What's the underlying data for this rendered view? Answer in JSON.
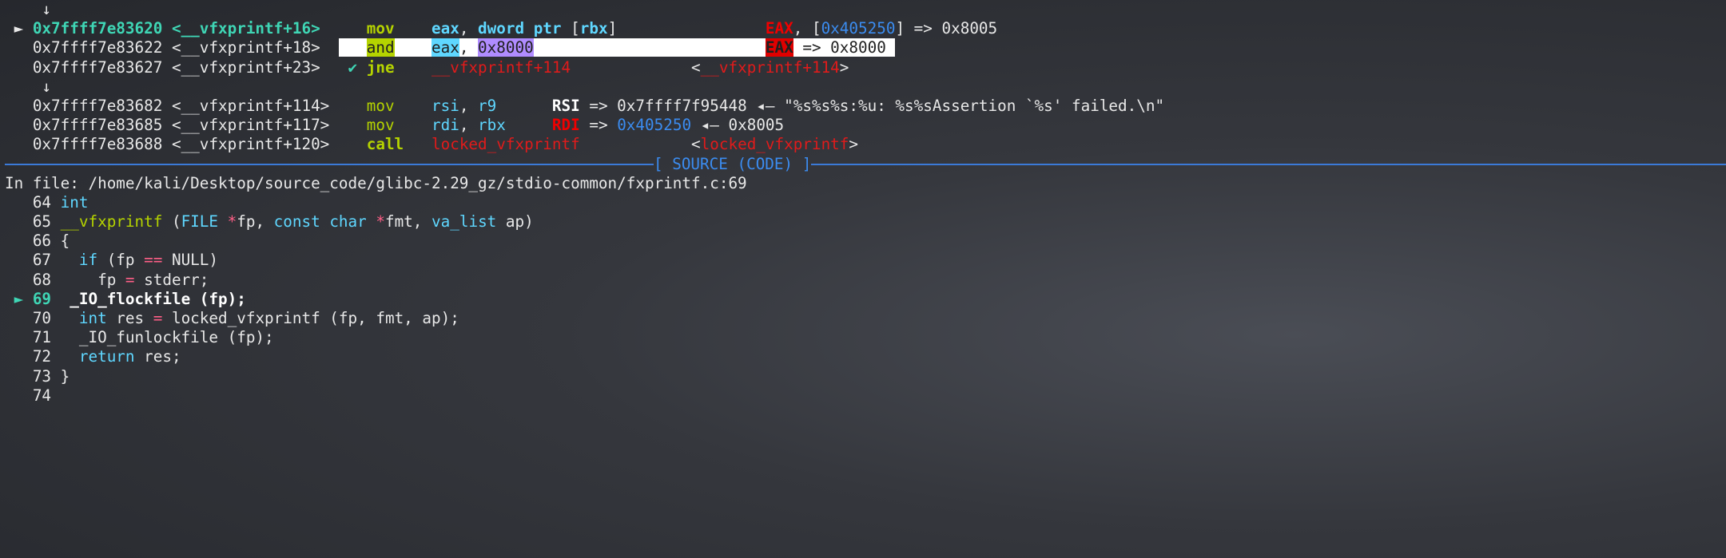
{
  "colors": {
    "address_current": "#3fd6b5",
    "mnemonic": "#b5d300",
    "register": "#5fd7ff",
    "symbol": "#e01b1b",
    "pointer": "#3b8cf0",
    "separator": "#3b7ad8",
    "operator": "#ff5f87"
  },
  "disasm": [
    [
      [
        "    ↓",
        "w"
      ]
    ],
    [
      [
        " ► ",
        "w"
      ],
      [
        "0x7ffff7e83620 <__vfxprintf+16>",
        "g"
      ],
      [
        "     ",
        "w"
      ],
      [
        "mov",
        "yb"
      ],
      [
        "    ",
        "w"
      ],
      [
        "eax",
        "cb"
      ],
      [
        ", ",
        "w"
      ],
      [
        "dword ptr",
        "cb"
      ],
      [
        " [",
        "w"
      ],
      [
        "rbx",
        "cb"
      ],
      [
        "]",
        "w"
      ],
      [
        "                ",
        "w"
      ],
      [
        "EAX",
        "rb"
      ],
      [
        ", [",
        "w"
      ],
      [
        "0x405250",
        "b"
      ],
      [
        "] => 0x8005",
        "w"
      ]
    ],
    [
      [
        "   0x7ffff7e83622 <__vfxprintf+18>  ",
        "w"
      ],
      [
        "   ",
        "hl"
      ],
      [
        "and",
        "hy"
      ],
      [
        "    ",
        "hl"
      ],
      [
        "eax",
        "hc"
      ],
      [
        ", ",
        "hl"
      ],
      [
        "0x8000",
        "hp"
      ],
      [
        "                         ",
        "hl"
      ],
      [
        "EAX",
        "hr"
      ],
      [
        " => 0x8000 ",
        "hl"
      ]
    ],
    [
      [
        "   0x7ffff7e83627 <__vfxprintf+23>   ",
        "w"
      ],
      [
        "✔",
        "g"
      ],
      [
        " ",
        "w"
      ],
      [
        "jne",
        "yb"
      ],
      [
        "    ",
        "w"
      ],
      [
        "__vfxprintf+114",
        "r"
      ],
      [
        "             ",
        "w"
      ],
      [
        "<",
        "w"
      ],
      [
        "__vfxprintf+114",
        "r"
      ],
      [
        ">",
        "w"
      ]
    ],
    [
      [
        "    ↓",
        "w"
      ]
    ],
    [
      [
        "   0x7ffff7e83682 <__vfxprintf+114>    ",
        "w"
      ],
      [
        "mov",
        "y"
      ],
      [
        "    ",
        "w"
      ],
      [
        "rsi",
        "c"
      ],
      [
        ", ",
        "w"
      ],
      [
        "r9",
        "c"
      ],
      [
        "      ",
        "w"
      ],
      [
        "RSI",
        "wb"
      ],
      [
        " => 0x7ffff7f95448 ◂— \"%s%s%s:%u: %s%sAssertion `%s' failed.\\n\"",
        "w"
      ]
    ],
    [
      [
        "   0x7ffff7e83685 <__vfxprintf+117>    ",
        "w"
      ],
      [
        "mov",
        "y"
      ],
      [
        "    ",
        "w"
      ],
      [
        "rdi",
        "c"
      ],
      [
        ", ",
        "w"
      ],
      [
        "rbx",
        "c"
      ],
      [
        "     ",
        "w"
      ],
      [
        "RDI",
        "rb"
      ],
      [
        " => ",
        "w"
      ],
      [
        "0x405250",
        "b"
      ],
      [
        " ◂— 0x8005",
        "w"
      ]
    ],
    [
      [
        "   0x7ffff7e83688 <__vfxprintf+120>    ",
        "w"
      ],
      [
        "call",
        "yb"
      ],
      [
        "   ",
        "w"
      ],
      [
        "locked_vfxprintf",
        "r"
      ],
      [
        "            ",
        "w"
      ],
      [
        "<",
        "w"
      ],
      [
        "locked_vfxprintf",
        "r"
      ],
      [
        ">",
        "w"
      ]
    ]
  ],
  "separator": {
    "title": "[ SOURCE (CODE) ]"
  },
  "source": {
    "file_line": "In file: /home/kali/Desktop/source_code/glibc-2.29_gz/stdio-common/fxprintf.c:69",
    "lines": [
      [
        [
          "   64 ",
          "w"
        ],
        [
          "int",
          "c"
        ]
      ],
      [
        [
          "   65 ",
          "w"
        ],
        [
          "__vfxprintf",
          "y"
        ],
        [
          " (",
          "w"
        ],
        [
          "FILE",
          "c"
        ],
        [
          " ",
          "w"
        ],
        [
          "*",
          "pk"
        ],
        [
          "fp, ",
          "w"
        ],
        [
          "const",
          "c"
        ],
        [
          " ",
          "w"
        ],
        [
          "char",
          "c"
        ],
        [
          " ",
          "w"
        ],
        [
          "*",
          "pk"
        ],
        [
          "fmt, ",
          "w"
        ],
        [
          "va_list",
          "c"
        ],
        [
          " ap)",
          "w"
        ]
      ],
      [
        [
          "   66 {",
          "w"
        ]
      ],
      [
        [
          "   67   ",
          "w"
        ],
        [
          "if",
          "c"
        ],
        [
          " (fp ",
          "w"
        ],
        [
          "==",
          "pk"
        ],
        [
          " NULL)",
          "w"
        ]
      ],
      [
        [
          "   68     fp ",
          "w"
        ],
        [
          "=",
          "pk"
        ],
        [
          " stderr;",
          "w"
        ]
      ],
      [
        [
          " ► ",
          "g"
        ],
        [
          "69",
          "g"
        ],
        [
          "  ",
          "w"
        ],
        [
          "_IO_flockfile (fp);",
          "wb"
        ]
      ],
      [
        [
          "   70   ",
          "w"
        ],
        [
          "int",
          "c"
        ],
        [
          " res ",
          "w"
        ],
        [
          "=",
          "pk"
        ],
        [
          " locked_vfxprintf (fp, fmt, ap);",
          "w"
        ]
      ],
      [
        [
          "   71   _IO_funlockfile (fp);",
          "w"
        ]
      ],
      [
        [
          "   72   ",
          "w"
        ],
        [
          "return",
          "c"
        ],
        [
          " res;",
          "w"
        ]
      ],
      [
        [
          "   73 }",
          "w"
        ]
      ],
      [
        [
          "   74",
          "w"
        ]
      ]
    ]
  }
}
